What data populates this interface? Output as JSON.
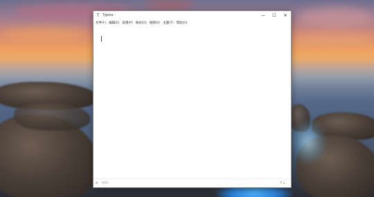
{
  "window": {
    "title": "Typora",
    "controls": {
      "minimize": "—",
      "maximize": "☐",
      "close": "✕"
    }
  },
  "menubar": {
    "items": [
      {
        "label": "文件(F)"
      },
      {
        "label": "编辑(E)"
      },
      {
        "label": "段落(P)"
      },
      {
        "label": "格式(O)"
      },
      {
        "label": "视图(V)"
      },
      {
        "label": "主题(T)"
      },
      {
        "label": "帮助(H)"
      }
    ]
  },
  "statusbar": {
    "left_icon_1": "⊙",
    "left_icon_2": "</>",
    "right_icon": "↑↓"
  },
  "icons": {
    "app": "typora-icon",
    "outline": "outline-toggle-icon",
    "source": "source-code-icon",
    "sort": "word-count-icon"
  }
}
